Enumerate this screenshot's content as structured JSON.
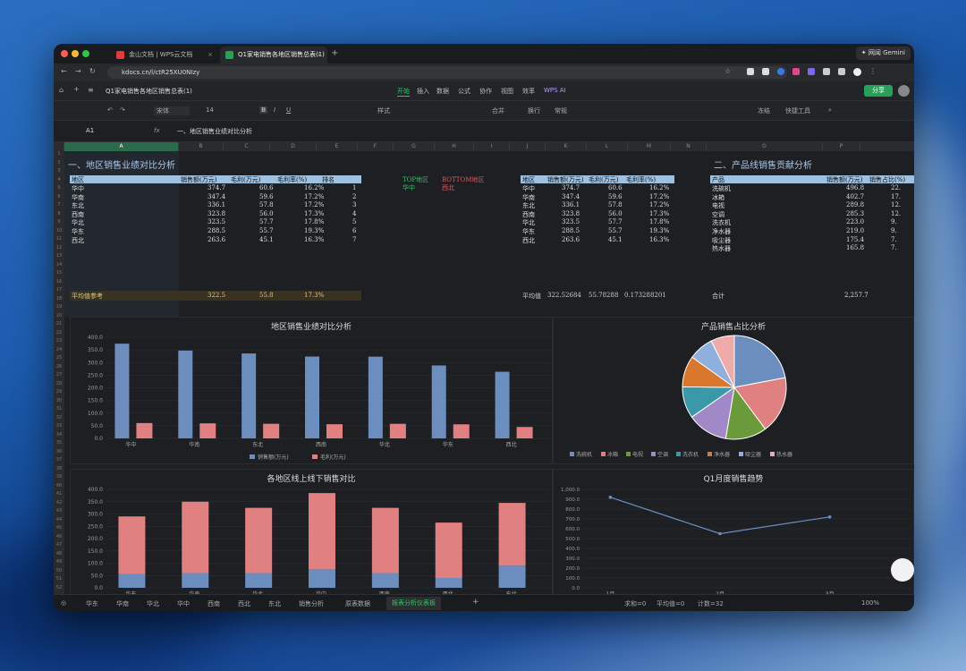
{
  "browser": {
    "tabs": [
      {
        "label": "金山文档 | WPS云文档",
        "icon_color": "#e63b3b"
      },
      {
        "label": "Q1家电销售各地区销售总表(1)",
        "icon_color": "#27a05a"
      }
    ],
    "url": "kdocs.cn/l/ctR25XU0NIzy",
    "profile": "网闻 Gemini"
  },
  "doc": {
    "title": "Q1家电销售各地区销售总表(1)",
    "menus": [
      "开始",
      "插入",
      "数据",
      "公式",
      "协作",
      "视图",
      "效率",
      "WPS AI"
    ],
    "share": "分享"
  },
  "toolbar": {
    "font": "宋体",
    "size": "14",
    "items": [
      "样式",
      "合并",
      "换行",
      "常规",
      "冻结",
      "快捷工具"
    ]
  },
  "formula": {
    "cell": "A1",
    "fx": "fx",
    "content": "一、地区销售业绩对比分析"
  },
  "columns": [
    "A",
    "B",
    "C",
    "D",
    "E",
    "F",
    "G",
    "H",
    "I",
    "J",
    "K",
    "L",
    "M",
    "N",
    "O",
    "P",
    "Q"
  ],
  "section1": {
    "title": "一、地区销售业绩对比分析",
    "headers": [
      "地区",
      "销售额(万元)",
      "毛利(万元)",
      "毛利率(%)",
      "排名"
    ],
    "rows": [
      [
        "华中",
        "374.7",
        "60.6",
        "16.2%",
        "1"
      ],
      [
        "华南",
        "347.4",
        "59.6",
        "17.2%",
        "2"
      ],
      [
        "东北",
        "336.1",
        "57.8",
        "17.2%",
        "3"
      ],
      [
        "西南",
        "323.8",
        "56.0",
        "17.3%",
        "4"
      ],
      [
        "华北",
        "323.5",
        "57.7",
        "17.8%",
        "5"
      ],
      [
        "华东",
        "288.5",
        "55.7",
        "19.3%",
        "6"
      ],
      [
        "西北",
        "263.6",
        "45.1",
        "16.3%",
        "7"
      ]
    ],
    "avg": [
      "平均值参考",
      "322.5",
      "55.8",
      "17.3%"
    ],
    "top_label": "TOP地区",
    "top_value": "华中",
    "bottom_label": "BOTTOM地区",
    "bottom_value": "西北"
  },
  "table2": {
    "headers": [
      "地区",
      "销售额(万元)",
      "毛利(万元)",
      "毛利率(%)"
    ],
    "rows": [
      [
        "华中",
        "374.7",
        "60.6",
        "16.2%"
      ],
      [
        "华南",
        "347.4",
        "59.6",
        "17.2%"
      ],
      [
        "东北",
        "336.1",
        "57.8",
        "17.2%"
      ],
      [
        "西南",
        "323.8",
        "56.0",
        "17.3%"
      ],
      [
        "华北",
        "323.5",
        "57.7",
        "17.8%"
      ],
      [
        "华东",
        "288.5",
        "55.7",
        "19.3%"
      ],
      [
        "西北",
        "263.6",
        "45.1",
        "16.3%"
      ]
    ],
    "avg": [
      "平均值",
      "322.52684",
      "55.78288",
      "0.173288201"
    ]
  },
  "section2": {
    "title": "二、产品线销售贡献分析",
    "headers": [
      "产品",
      "销售额(万元)",
      "销售占比(%)"
    ],
    "rows": [
      [
        "洗碗机",
        "496.8",
        "22."
      ],
      [
        "冰箱",
        "402.7",
        "17."
      ],
      [
        "电视",
        "289.8",
        "12."
      ],
      [
        "空调",
        "285.3",
        "12."
      ],
      [
        "洗衣机",
        "223.0",
        "9."
      ],
      [
        "净水器",
        "219.0",
        "9."
      ],
      [
        "吸尘器",
        "175.4",
        "7."
      ],
      [
        "热水器",
        "165.8",
        "7."
      ]
    ],
    "total": [
      "合计",
      "2,257.7"
    ]
  },
  "sheets": [
    "华东",
    "华南",
    "华北",
    "华中",
    "西南",
    "西北",
    "东北",
    "销售分析",
    "原表数据",
    "报表分析仪表板"
  ],
  "status": {
    "sum": "求和=0",
    "avg": "平均值=0",
    "count": "计数=32",
    "zoom": "100%"
  },
  "chart_data": [
    {
      "type": "bar",
      "title": "地区销售业绩对比分析",
      "categories": [
        "华中",
        "华南",
        "东北",
        "西南",
        "华北",
        "华东",
        "西北"
      ],
      "series": [
        {
          "name": "销售额(万元)",
          "values": [
            374.7,
            347.4,
            336.1,
            323.8,
            323.5,
            288.5,
            263.6
          ],
          "color": "#6c8ebf"
        },
        {
          "name": "毛利(万元)",
          "values": [
            60.6,
            59.6,
            57.8,
            56.0,
            57.7,
            55.7,
            45.1
          ],
          "color": "#e08080"
        }
      ],
      "ylim": [
        0,
        400
      ],
      "yticks": [
        "0.0",
        "50.0",
        "100.0",
        "150.0",
        "200.0",
        "250.0",
        "300.0",
        "350.0",
        "400.0"
      ]
    },
    {
      "type": "pie",
      "title": "产品销售占比分析",
      "categories": [
        "洗碗机",
        "冰箱",
        "电视",
        "空调",
        "洗衣机",
        "净水器",
        "吸尘器",
        "热水器"
      ],
      "values": [
        496.8,
        402.7,
        289.8,
        285.3,
        223.0,
        219.0,
        175.4,
        165.8
      ],
      "colors": [
        "#6c8ebf",
        "#e08080",
        "#6a9a3a",
        "#a089c6",
        "#3a99a8",
        "#d9782c",
        "#8fb0dc",
        "#efaaaa"
      ]
    },
    {
      "type": "bar",
      "title": "各地区线上线下销售对比",
      "categories": [
        "华东",
        "华南",
        "华北",
        "华中",
        "西南",
        "西北",
        "东北"
      ],
      "series": [
        {
          "name": "线上销售(万元)",
          "values": [
            55,
            60,
            60,
            75,
            60,
            40,
            90
          ],
          "color": "#6c8ebf"
        },
        {
          "name": "线下销售(万元)",
          "values": [
            235,
            290,
            265,
            310,
            265,
            225,
            255
          ],
          "color": "#e08080"
        }
      ],
      "stacked": true,
      "ylim": [
        0,
        400
      ],
      "yticks": [
        "0.0",
        "50.0",
        "100.0",
        "150.0",
        "200.0",
        "250.0",
        "300.0",
        "350.0",
        "400.0"
      ]
    },
    {
      "type": "line",
      "title": "Q1月度销售趋势",
      "categories": [
        "1月",
        "2月",
        "3月"
      ],
      "series": [
        {
          "name": "销售额(万元)",
          "values": [
            920,
            550,
            720
          ],
          "color": "#6c8ebf"
        }
      ],
      "ylim": [
        0,
        1000
      ],
      "yticks": [
        "0.0",
        "100.0",
        "200.0",
        "300.0",
        "400.0",
        "500.0",
        "600.0",
        "700.0",
        "800.0",
        "900.0",
        "1,000.0"
      ]
    }
  ]
}
